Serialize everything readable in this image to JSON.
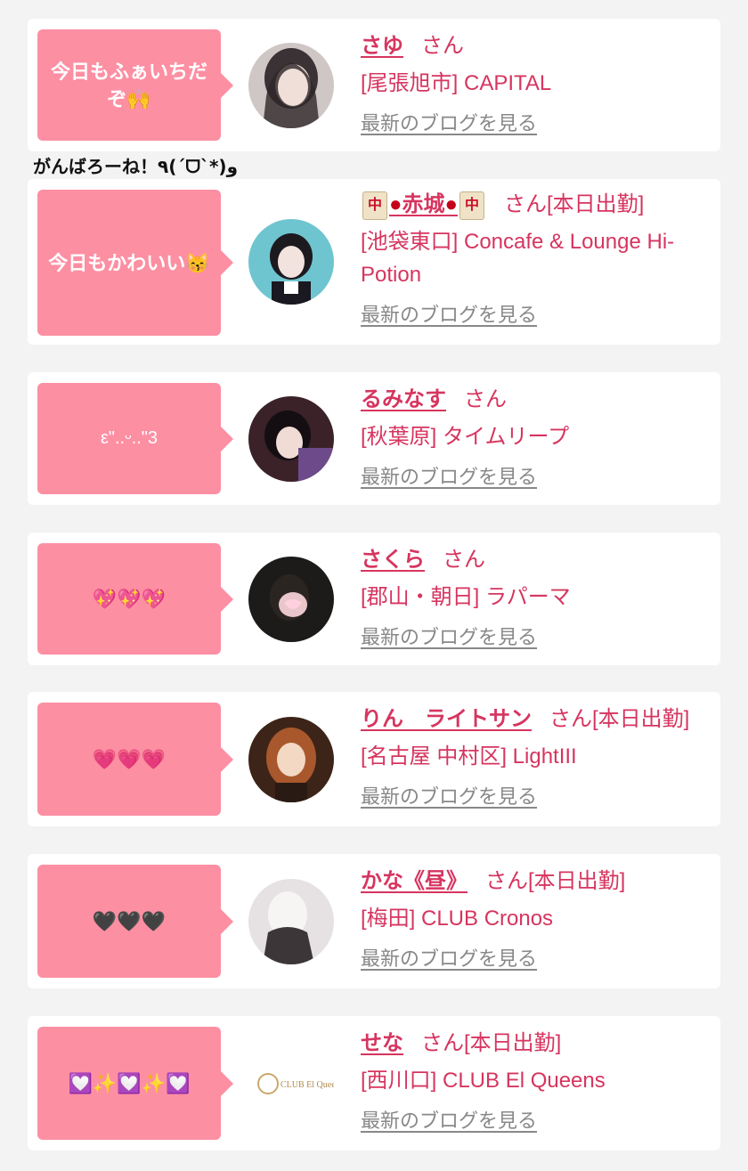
{
  "floating_message": "がんばろーね！٩(ˊᗜˋ*)و",
  "blog_label": "最新のブログを見る",
  "honorific": "さん",
  "cards": [
    {
      "comment": "今日もふぁいちだぞ🙌",
      "name": "さゆ",
      "status": "",
      "area_shop": "[尾張旭市] CAPITAL"
    },
    {
      "comment": "今日もかわいい😽",
      "name": "赤城",
      "name_decor": "🀄🩸",
      "status": "[本日出勤]",
      "area_shop": "[池袋東口] Concafe & Lounge Hi-Potion"
    },
    {
      "comment": "ε\"..ᵕ..\"3",
      "name": "るみなす",
      "status": "",
      "area_shop": "[秋葉原] タイムリープ"
    },
    {
      "comment": "💖💖💖",
      "name": "さくら",
      "status": "",
      "area_shop": "[郡山・朝日] ラパーマ"
    },
    {
      "comment": "💗💗💗",
      "name": "りん　ライトサン",
      "status": "[本日出勤]",
      "area_shop": "[名古屋 中村区] LightIII"
    },
    {
      "comment": "🖤🖤🖤",
      "name": "かな《昼》",
      "status": "[本日出勤]",
      "area_shop": "[梅田] CLUB Cronos"
    },
    {
      "comment": "💟✨💟✨💟",
      "name": "せな",
      "status": "[本日出勤]",
      "area_shop": "[西川口] CLUB El Queens",
      "logo_text": "CLUB El Queens"
    }
  ]
}
